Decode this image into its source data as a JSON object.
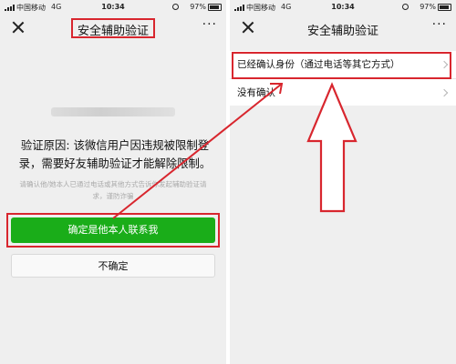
{
  "status_bar": {
    "carrier": "中国移动",
    "network": "4G",
    "time": "10:34",
    "battery": "97%"
  },
  "left_screen": {
    "title": "安全辅助验证",
    "more_label": "···",
    "reason_text": "验证原因: 该微信用户因违规被限制登录，需要好友辅助验证才能解除限制。",
    "hint_text": "请确认他/她本人已通过电话或其他方式告诉你发起辅助验证请求，谨防诈骗",
    "confirm_button": "确定是他本人联系我",
    "unsure_button": "不确定"
  },
  "right_screen": {
    "title": "安全辅助验证",
    "more_label": "···",
    "items": [
      {
        "label": "已经确认身份（通过电话等其它方式）"
      },
      {
        "label": "没有确认"
      }
    ]
  },
  "colors": {
    "wechat_green": "#1aad19",
    "highlight_red": "#d8262e",
    "background": "#efefef"
  }
}
